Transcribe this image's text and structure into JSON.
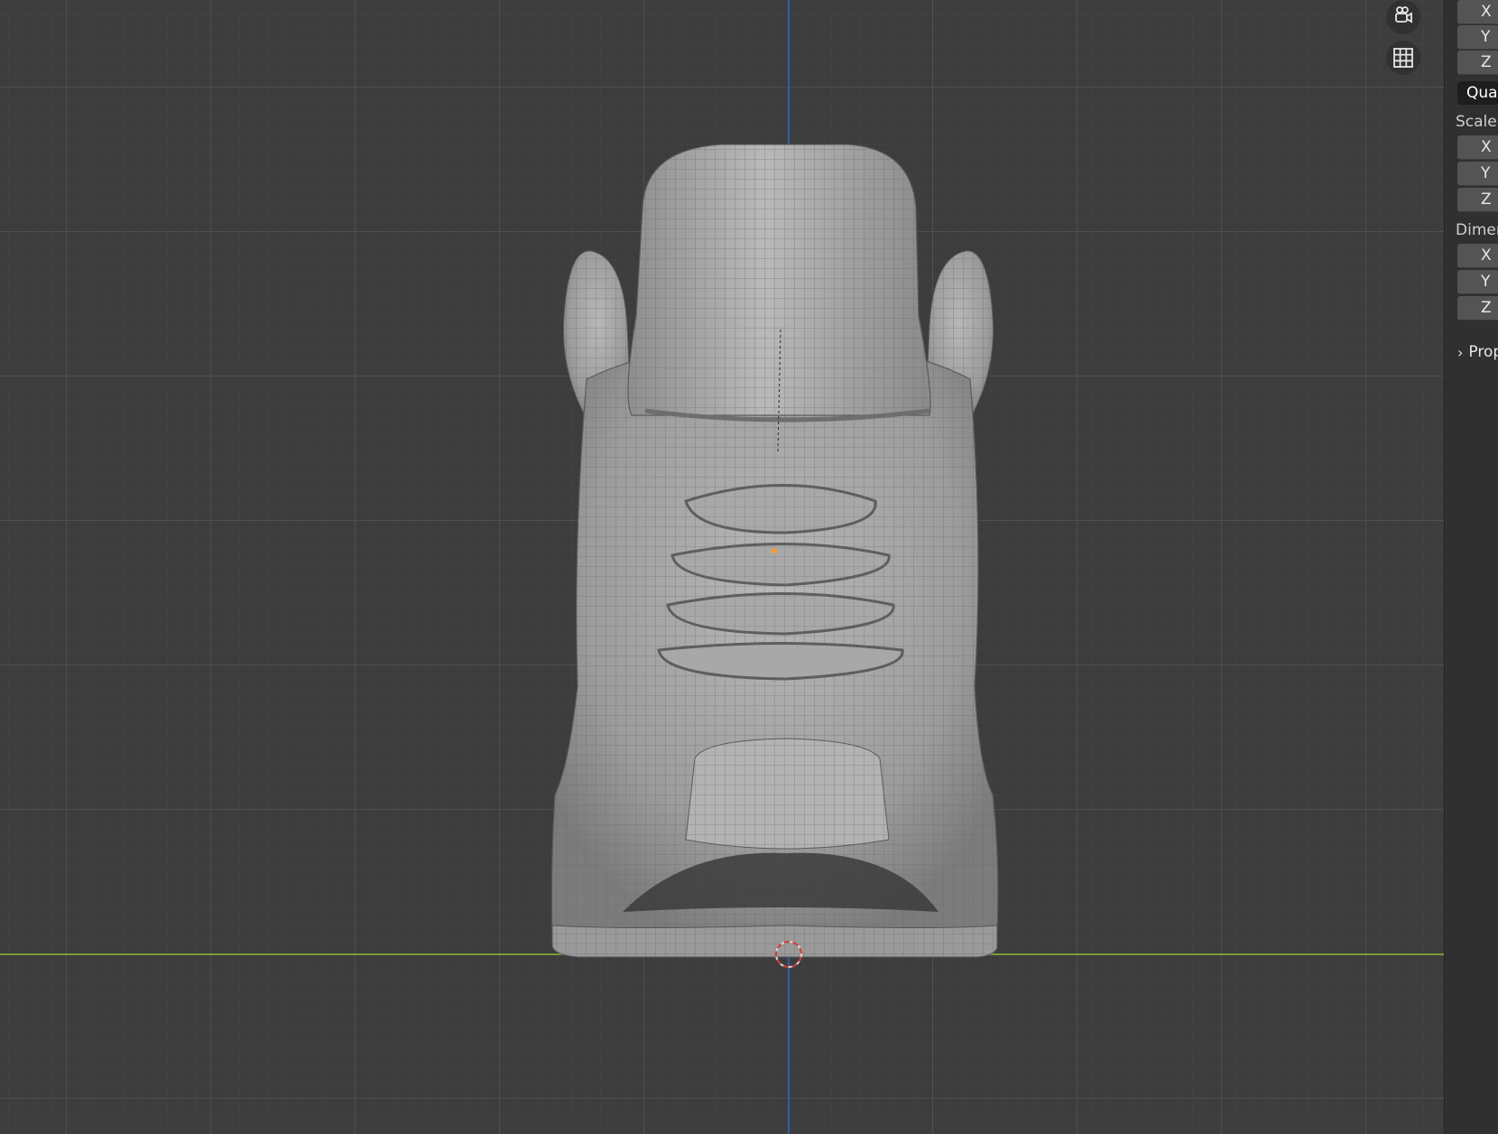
{
  "viewport": {
    "colors": {
      "background": "#3d3d3d",
      "axis_x": "#7d9a35",
      "axis_y": "#2f5fa8",
      "mesh": "#a7a7a7"
    },
    "icons": {
      "camera": "camera-rotate-icon",
      "grid": "grid-view-icon"
    }
  },
  "npanel": {
    "rotation": {
      "axes": [
        "X",
        "Y",
        "Z"
      ],
      "mode": "Quat"
    },
    "scale": {
      "label": "Scale:",
      "axes": [
        "X",
        "Y",
        "Z"
      ]
    },
    "dimensions": {
      "label": "Dimen",
      "axes": [
        "X",
        "Y",
        "Z"
      ]
    },
    "properties": {
      "label": "Prop"
    }
  }
}
